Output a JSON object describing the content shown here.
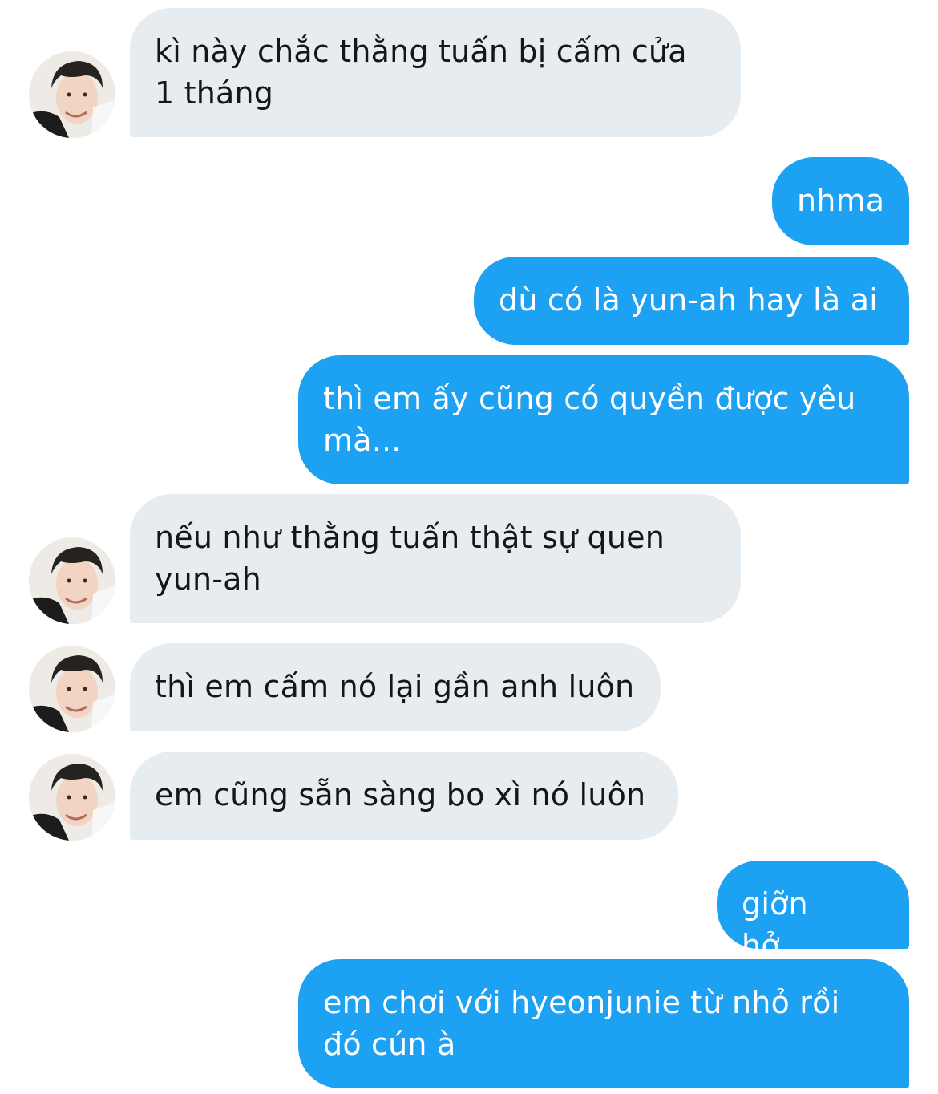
{
  "thread": {
    "messages": [
      {
        "side": "incoming",
        "text": "kì này chắc thằng tuấn bị cấm cửa\n1 tháng",
        "avatar": "contact-avatar-photo"
      },
      {
        "side": "outgoing",
        "text": "nhma"
      },
      {
        "side": "outgoing",
        "text": "dù có là yun-ah hay là ai"
      },
      {
        "side": "outgoing",
        "text": "thì em ấy cũng có quyền được yêu\nmà..."
      },
      {
        "side": "incoming",
        "text": "nếu như thằng tuấn thật sự quen\nyun-ah",
        "avatar": "contact-avatar-photo"
      },
      {
        "side": "incoming",
        "text": "thì em cấm nó lại gần anh luôn",
        "avatar": "contact-avatar-photo"
      },
      {
        "side": "incoming",
        "text": "em cũng sẵn sàng bo xì nó luôn",
        "avatar": "contact-avatar-photo"
      },
      {
        "side": "outgoing",
        "text": "giỡn hở..."
      },
      {
        "side": "outgoing",
        "text": "em chơi với hyeonjunie từ nhỏ rồi\nđó cún à"
      }
    ]
  },
  "colors": {
    "incoming_bubble": "#e7ecf0",
    "incoming_text": "#14171a",
    "outgoing_bubble": "#1da1f2",
    "outgoing_text": "#ffffff"
  }
}
